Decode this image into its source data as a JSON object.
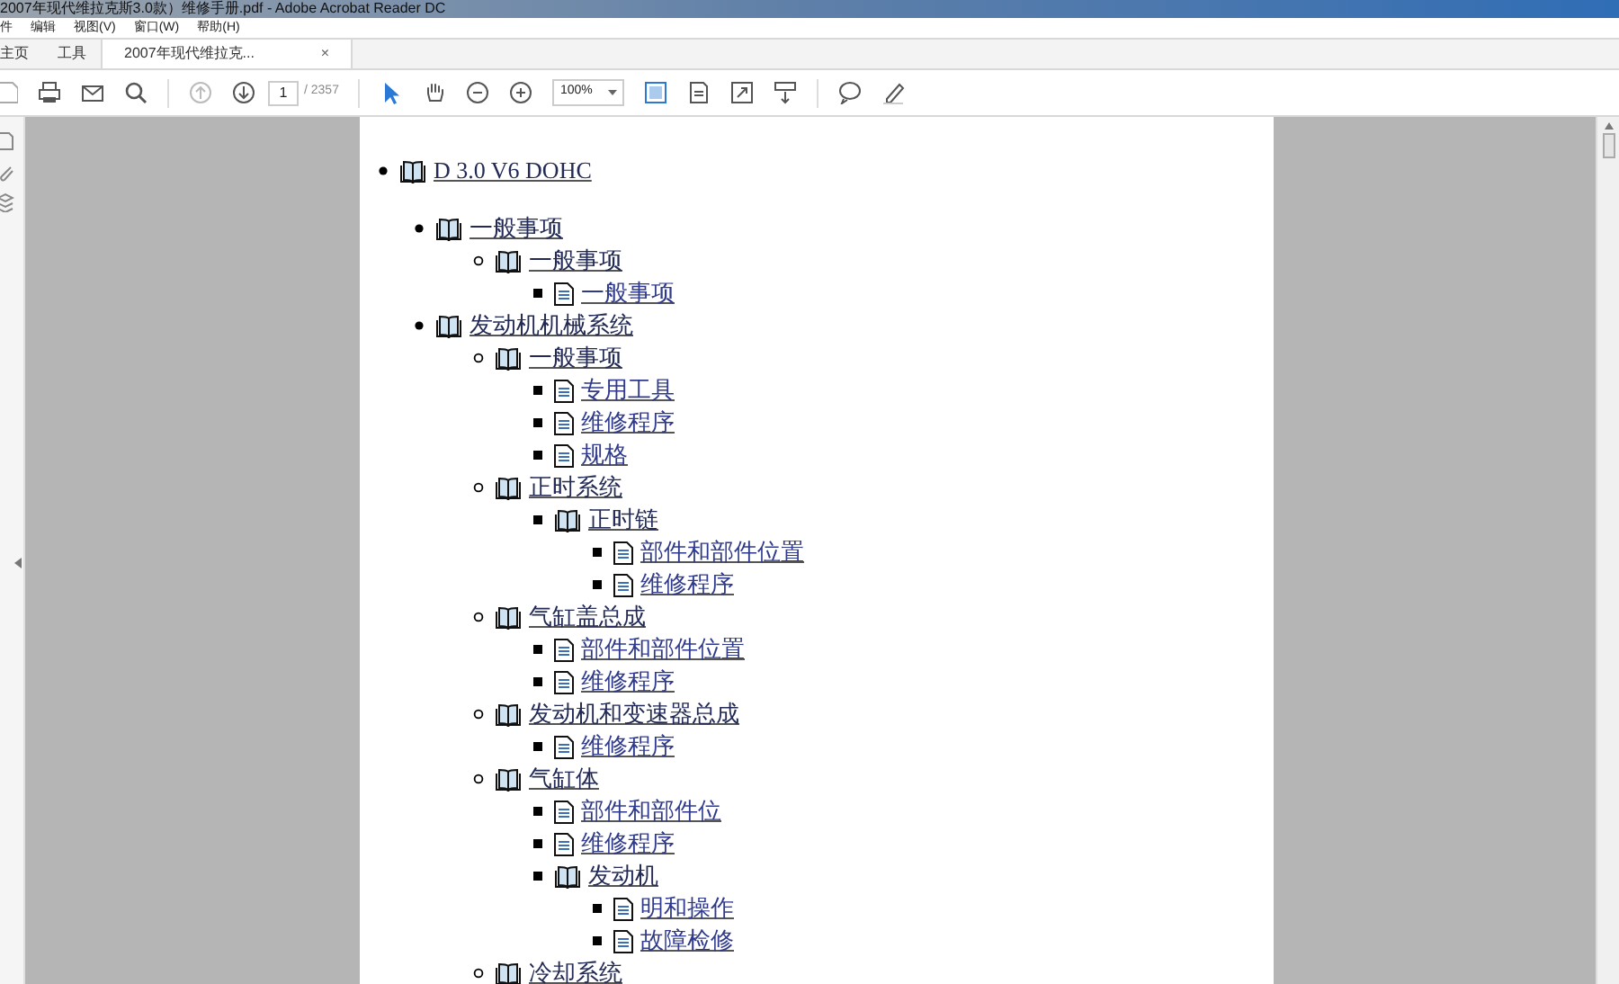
{
  "window": {
    "title": "2007年现代维拉克斯3.0款）维修手册.pdf - Adobe Acrobat Reader DC"
  },
  "menu": [
    "件",
    "编辑",
    "视图(V)",
    "窗口(W)",
    "帮助(H)"
  ],
  "tabs": [
    {
      "label": "主页",
      "selected": false
    },
    {
      "label": "工具",
      "selected": false
    },
    {
      "label": "2007年现代维拉克...",
      "selected": true,
      "close": "×"
    }
  ],
  "toolbar": {
    "page": "1",
    "page_count": "/ 2357",
    "zoom": "100%"
  },
  "outline": [
    {
      "kind": "book",
      "label": "D 3.0 V6 DOHC",
      "children": [
        {
          "kind": "book",
          "label": "一般事项",
          "children": [
            {
              "kind": "book",
              "label": "一般事项",
              "children": [
                {
                  "kind": "page",
                  "label": "一般事项"
                }
              ]
            }
          ]
        },
        {
          "kind": "book",
          "label": "发动机机械系统",
          "children": [
            {
              "kind": "book",
              "label": "一般事项",
              "children": [
                {
                  "kind": "page",
                  "label": "专用工具"
                },
                {
                  "kind": "page",
                  "label": "维修程序"
                },
                {
                  "kind": "page",
                  "label": "规格"
                }
              ]
            },
            {
              "kind": "book",
              "label": "正时系统",
              "children": [
                {
                  "kind": "book",
                  "label": "正时链",
                  "children": [
                    {
                      "kind": "page",
                      "label": "部件和部件位置"
                    },
                    {
                      "kind": "page",
                      "label": "维修程序"
                    }
                  ]
                }
              ]
            },
            {
              "kind": "book",
              "label": "气缸盖总成",
              "children": [
                {
                  "kind": "page",
                  "label": "部件和部件位置"
                },
                {
                  "kind": "page",
                  "label": "维修程序"
                }
              ]
            },
            {
              "kind": "book",
              "label": "发动机和变速器总成",
              "children": [
                {
                  "kind": "page",
                  "label": "维修程序"
                }
              ]
            },
            {
              "kind": "book",
              "label": "气缸体",
              "children": [
                {
                  "kind": "page",
                  "label": "部件和部件位"
                },
                {
                  "kind": "page",
                  "label": "维修程序"
                },
                {
                  "kind": "book",
                  "label": "发动机",
                  "children": [
                    {
                      "kind": "page",
                      "label": "明和操作"
                    },
                    {
                      "kind": "page",
                      "label": "故障检修"
                    }
                  ]
                }
              ]
            },
            {
              "kind": "book",
              "label": "冷却系统"
            }
          ]
        }
      ]
    }
  ]
}
